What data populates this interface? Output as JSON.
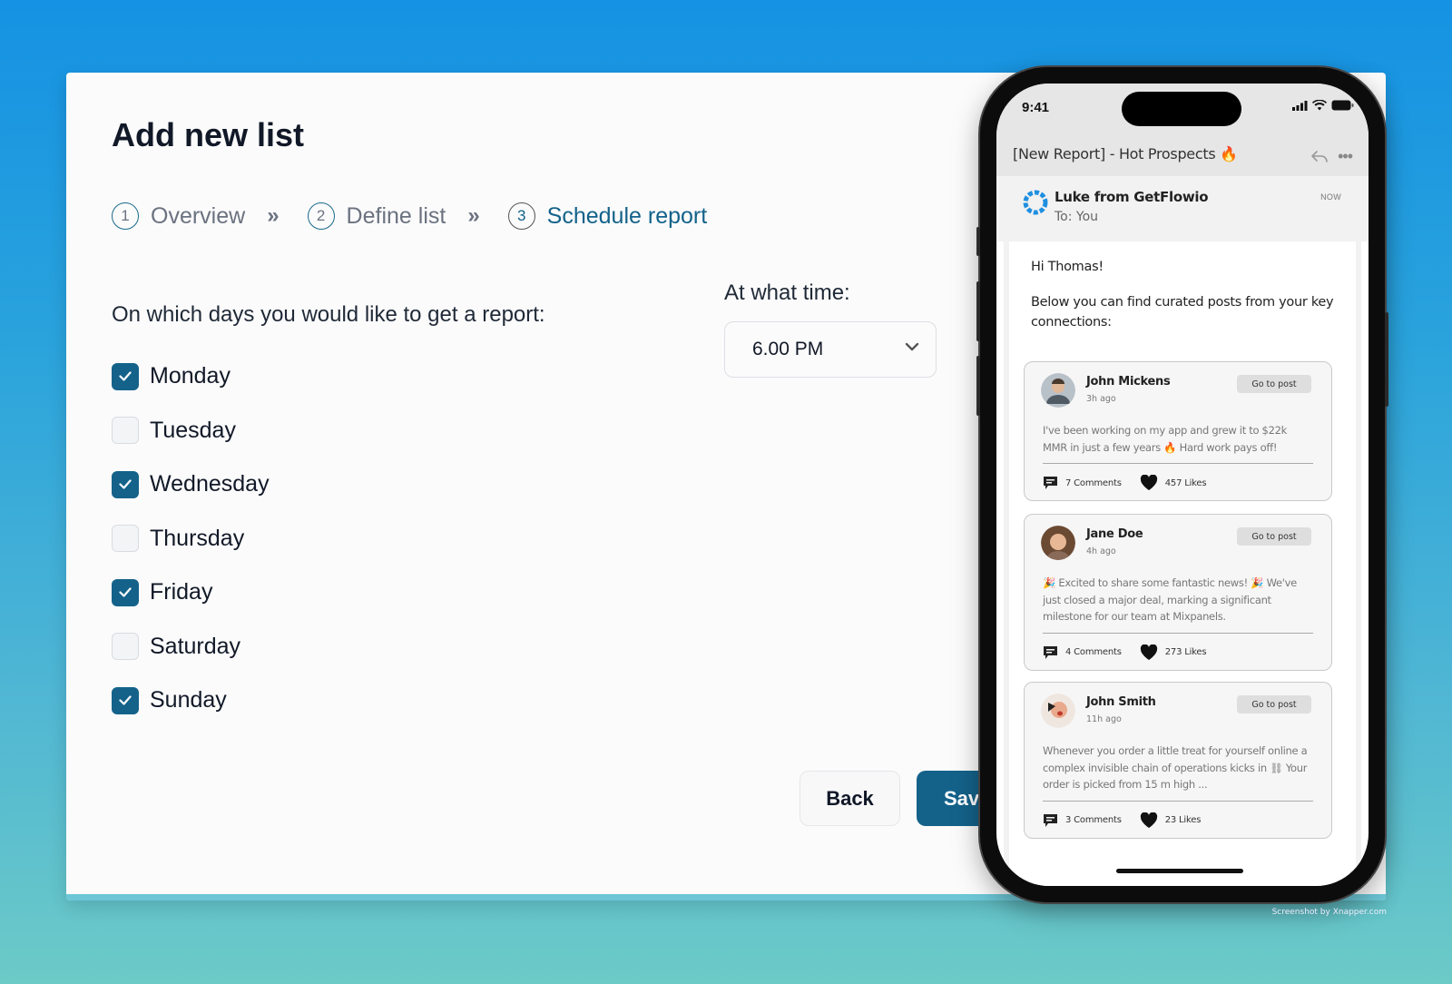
{
  "page": {
    "title": "Add new list",
    "steps": [
      {
        "number": "1",
        "label": "Overview",
        "state": "done"
      },
      {
        "number": "2",
        "label": "Define list",
        "state": "done"
      },
      {
        "number": "3",
        "label": "Schedule report",
        "state": "active"
      }
    ],
    "step_separator": "»",
    "days_label": "On which days you would like to get a report:",
    "days": [
      {
        "label": "Monday",
        "checked": true
      },
      {
        "label": "Tuesday",
        "checked": false
      },
      {
        "label": "Wednesday",
        "checked": true
      },
      {
        "label": "Thursday",
        "checked": false
      },
      {
        "label": "Friday",
        "checked": true
      },
      {
        "label": "Saturday",
        "checked": false
      },
      {
        "label": "Sunday",
        "checked": true
      }
    ],
    "time_label": "At what time:",
    "time_value": "6.00 PM",
    "back_label": "Back",
    "save_label": "Save"
  },
  "phone": {
    "clock": "9:41",
    "subject": "[New Report] - Hot Prospects 🔥",
    "sender": "Luke from GetFlowio",
    "to": "To: You",
    "time": "NOW",
    "greeting": "Hi Thomas!",
    "intro": "Below you can find curated posts from your key connections:",
    "posts": [
      {
        "name": "John Mickens",
        "time": "3h ago",
        "button": "Go to post",
        "text": "I've been working on my app and grew it to $22k MMR in just a few years 🔥 Hard work pays off!",
        "comments": "7 Comments",
        "likes": "457 Likes"
      },
      {
        "name": "Jane Doe",
        "time": "4h ago",
        "button": "Go to post",
        "text": "🎉 Excited to share some fantastic news! 🎉 We've just closed a major deal, marking a significant milestone for our team at Mixpanels.",
        "comments": "4 Comments",
        "likes": "273 Likes"
      },
      {
        "name": "John Smith",
        "time": "11h ago",
        "button": "Go to post",
        "text": "Whenever you order a little treat for yourself online a complex invisible chain of operations kicks in ⛓ Your order is picked from 15 m high ...",
        "comments": "3 Comments",
        "likes": "23 Likes"
      }
    ]
  },
  "credit": "Screenshot by Xnapper.com",
  "colors": {
    "accent": "#14628a",
    "background_top": "#1592e3",
    "background_bottom": "#6ccac7"
  }
}
